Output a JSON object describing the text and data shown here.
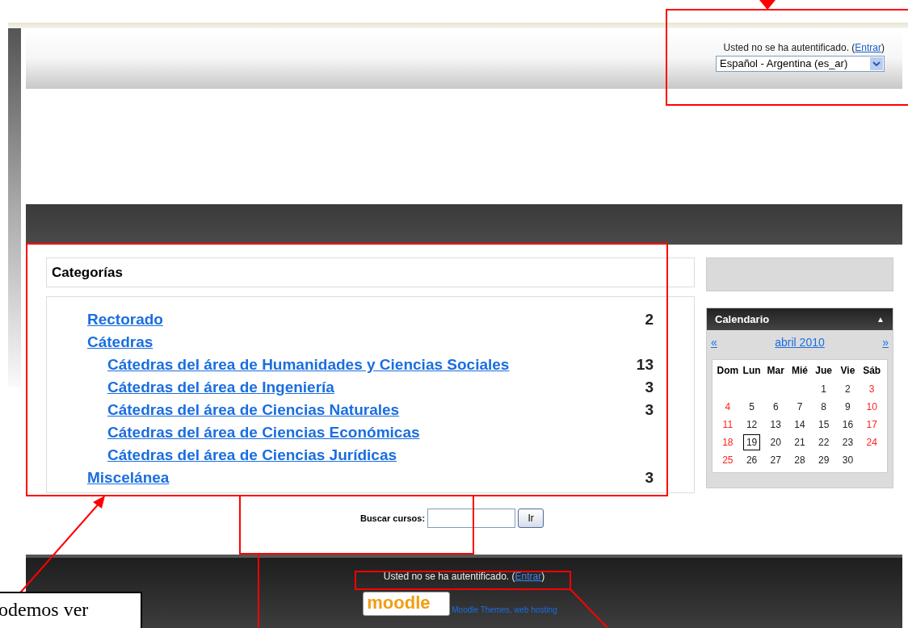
{
  "header": {
    "login_status": "Usted no se ha autentificado. (",
    "login_link": "Entrar",
    "login_close": ")",
    "language": "Español - Argentina (es_ar)"
  },
  "categories": {
    "title": "Categorías",
    "items": [
      {
        "name": "Rectorado",
        "count": "2"
      },
      {
        "name": "Cátedras",
        "children": [
          {
            "name": "Cátedras del área de Humanidades y Ciencias Sociales",
            "count": "13"
          },
          {
            "name": "Cátedras del área de Ingeniería",
            "count": "3"
          },
          {
            "name": "Cátedras del área de Ciencias Naturales",
            "count": "3"
          },
          {
            "name": "Cátedras del área de Ciencias Económicas"
          },
          {
            "name": "Cátedras del área de Ciencias Jurídicas"
          }
        ]
      },
      {
        "name": "Miscelánea",
        "count": "3"
      }
    ]
  },
  "calendar": {
    "title": "Calendario",
    "collapse_icon": "▲",
    "prev": "«",
    "month": "abril 2010",
    "next": "»",
    "weekdays": [
      "Dom",
      "Lun",
      "Mar",
      "Mié",
      "Jue",
      "Vie",
      "Sáb"
    ],
    "weeks": [
      [
        {
          "day": "1",
          "weekend": false,
          "today": false
        },
        {
          "day": "2",
          "weekend": false,
          "today": false
        },
        {
          "day": "3",
          "weekend": true,
          "today": false
        }
      ],
      [
        {
          "day": "4",
          "weekend": true,
          "today": false
        },
        {
          "day": "5",
          "weekend": false,
          "today": false
        },
        {
          "day": "6",
          "weekend": false,
          "today": false
        },
        {
          "day": "7",
          "weekend": false,
          "today": false
        },
        {
          "day": "8",
          "weekend": false,
          "today": false
        },
        {
          "day": "9",
          "weekend": false,
          "today": false
        },
        {
          "day": "10",
          "weekend": true,
          "today": false
        }
      ],
      [
        {
          "day": "11",
          "weekend": true,
          "today": false
        },
        {
          "day": "12",
          "weekend": false,
          "today": false
        },
        {
          "day": "13",
          "weekend": false,
          "today": false
        },
        {
          "day": "14",
          "weekend": false,
          "today": false
        },
        {
          "day": "15",
          "weekend": false,
          "today": false
        },
        {
          "day": "16",
          "weekend": false,
          "today": false
        },
        {
          "day": "17",
          "weekend": true,
          "today": false
        }
      ],
      [
        {
          "day": "18",
          "weekend": true,
          "today": false
        },
        {
          "day": "19",
          "weekend": false,
          "today": true
        },
        {
          "day": "20",
          "weekend": false,
          "today": false
        },
        {
          "day": "21",
          "weekend": false,
          "today": false
        },
        {
          "day": "22",
          "weekend": false,
          "today": false
        },
        {
          "day": "23",
          "weekend": false,
          "today": false
        },
        {
          "day": "24",
          "weekend": true,
          "today": false
        }
      ],
      [
        {
          "day": "25",
          "weekend": true,
          "today": false
        },
        {
          "day": "26",
          "weekend": false,
          "today": false
        },
        {
          "day": "27",
          "weekend": false,
          "today": false
        },
        {
          "day": "28",
          "weekend": false,
          "today": false
        },
        {
          "day": "29",
          "weekend": false,
          "today": false
        },
        {
          "day": "30",
          "weekend": false,
          "today": false
        }
      ]
    ]
  },
  "search": {
    "label": "Buscar cursos:",
    "button": "Ir"
  },
  "footer": {
    "login_status": "Usted no se ha autentificado. (",
    "login_link": "Entrar",
    "login_close": ")",
    "logo": "moodle",
    "credits": "Moodle Themes, web hosting"
  },
  "callout": {
    "text": "odemos ver"
  }
}
